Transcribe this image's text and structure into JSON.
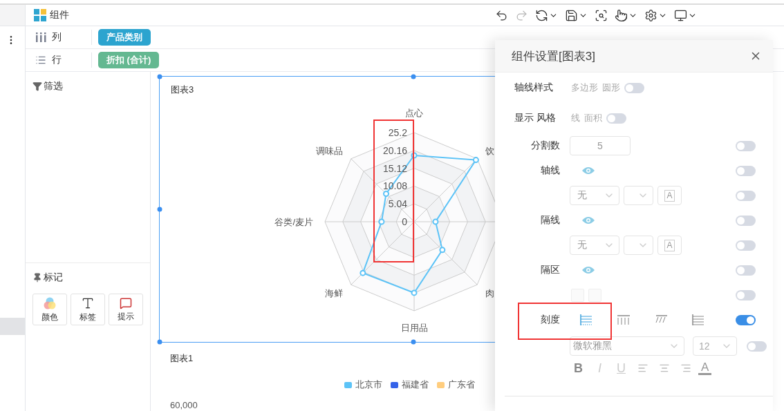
{
  "header": {
    "title": "组件"
  },
  "toolbar": [
    {
      "kind": "undo",
      "disabled": false,
      "menu": false
    },
    {
      "kind": "redo",
      "disabled": true,
      "menu": false
    },
    {
      "kind": "refresh",
      "disabled": false,
      "menu": true
    },
    {
      "kind": "save",
      "disabled": false,
      "menu": true
    },
    {
      "kind": "preview",
      "disabled": false,
      "menu": false
    },
    {
      "kind": "hand",
      "disabled": false,
      "menu": true
    },
    {
      "kind": "settings",
      "disabled": false,
      "menu": true
    },
    {
      "kind": "monitor",
      "disabled": false,
      "menu": true
    }
  ],
  "shelves": [
    {
      "kind": "columns",
      "label": "列",
      "pill": "产品类别",
      "color": "#2ca4cf"
    },
    {
      "kind": "rows",
      "label": "行",
      "pill": "折扣 (合计)",
      "color": "#64b891"
    }
  ],
  "filter_panel": {
    "title": "筛选"
  },
  "marks_panel": {
    "title": "标记",
    "buttons": [
      {
        "kind": "color",
        "label": "颜色"
      },
      {
        "kind": "text",
        "label": "标签"
      },
      {
        "kind": "tooltip",
        "label": "提示"
      }
    ]
  },
  "radar_card": {
    "title": "图表3",
    "selected": true,
    "axis_labels": [
      {
        "kind": "label",
        "text": "点心"
      },
      {
        "kind": "label",
        "text": "饮"
      },
      {
        "kind": "covered"
      },
      {
        "kind": "label",
        "text": "肉"
      },
      {
        "kind": "label",
        "text": "日用品"
      },
      {
        "kind": "label",
        "text": "海鲜"
      },
      {
        "kind": "label",
        "text": "谷类/麦片"
      },
      {
        "kind": "label",
        "text": "调味品"
      }
    ],
    "tick_labels": [
      "25.2",
      "20.16",
      "15.12",
      "10.08",
      "5.04",
      "0"
    ]
  },
  "chart_card": {
    "title": "图表1",
    "legend": [
      {
        "label": "北京市",
        "color": "#5cc3f7"
      },
      {
        "label": "福建省",
        "color": "#3563e9"
      },
      {
        "label": "广东省",
        "color": "#ffcd7e"
      }
    ],
    "y_tick": "60,000"
  },
  "settings_panel": {
    "title": "组件设置[图表3]",
    "rows": [
      {
        "kind": "options",
        "label": "轴线样式",
        "options": [
          "多边形",
          "圆形"
        ],
        "on": false
      },
      {
        "kind": "options",
        "label": "显示 风格",
        "options": [
          "线",
          "面积"
        ],
        "on": false
      },
      {
        "kind": "number",
        "label": "分割数",
        "value": "5",
        "on": false
      },
      {
        "kind": "eye",
        "label": "轴线",
        "on": false
      },
      {
        "kind": "line_style",
        "value": "无",
        "color_label": "A",
        "on": false
      },
      {
        "kind": "eye",
        "label": "隔线",
        "on": false
      },
      {
        "kind": "line_style",
        "value": "无",
        "color_label": "A",
        "on": false
      },
      {
        "kind": "eye",
        "label": "隔区",
        "on": false
      },
      {
        "kind": "swatches",
        "on": false
      },
      {
        "kind": "tick_style",
        "label": "刻度",
        "styles": [
          {
            "selected": true
          },
          {
            "selected": false
          },
          {
            "selected": false
          },
          {
            "selected": false
          }
        ],
        "on": true
      },
      {
        "kind": "font",
        "font": "微软雅黑",
        "size": "12",
        "on": false
      },
      {
        "kind": "format",
        "buttons": [
          "B",
          "I",
          "U"
        ],
        "color_label": "A"
      }
    ]
  }
}
